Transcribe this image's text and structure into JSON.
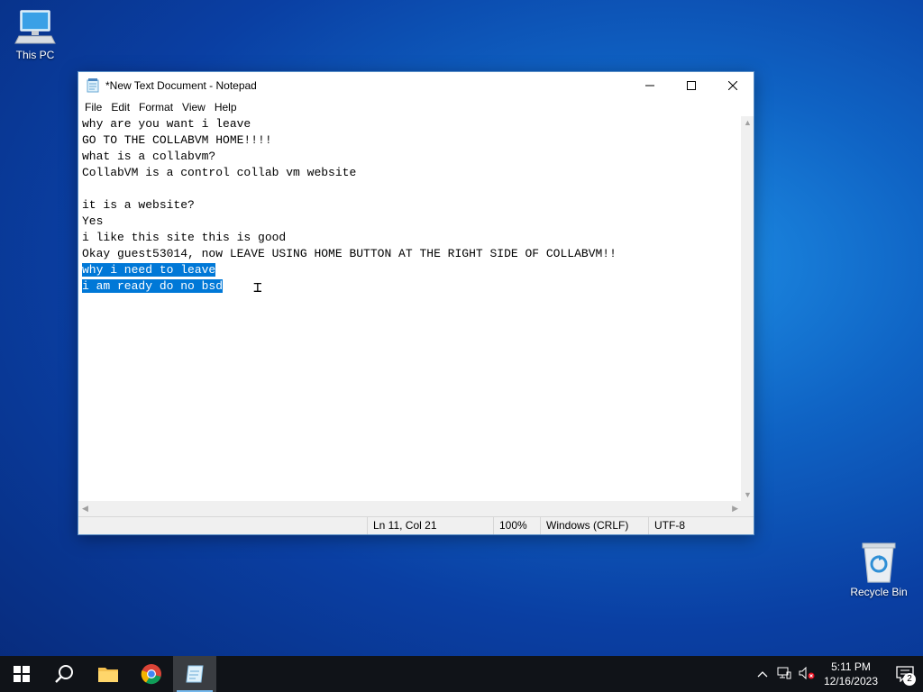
{
  "desktop": {
    "icons": [
      {
        "label": "This PC",
        "icon": "computer-icon"
      },
      {
        "label": "Recycle Bin",
        "icon": "recycle-bin-icon"
      }
    ]
  },
  "window": {
    "title": "*New Text Document - Notepad",
    "menu": [
      "File",
      "Edit",
      "Format",
      "View",
      "Help"
    ],
    "lines": [
      {
        "text": "why are you want i leave",
        "selected": false
      },
      {
        "text": "GO TO THE COLLABVM HOME!!!!",
        "selected": false
      },
      {
        "text": "what is a collabvm?",
        "selected": false
      },
      {
        "text": "CollabVM is a control collab vm website",
        "selected": false
      },
      {
        "text": "",
        "selected": false
      },
      {
        "text": "it is a website?",
        "selected": false
      },
      {
        "text": "Yes",
        "selected": false
      },
      {
        "text": "i like this site this is good",
        "selected": false
      },
      {
        "text": "Okay guest53014, now LEAVE USING HOME BUTTON AT THE RIGHT SIDE OF COLLABVM!!",
        "selected": false
      },
      {
        "text": "why i need to leave",
        "selected": true
      },
      {
        "text": "i am ready do no bsd",
        "selected": true
      }
    ],
    "status": {
      "position": "Ln 11, Col 21",
      "zoom": "100%",
      "line_ending": "Windows (CRLF)",
      "encoding": "UTF-8"
    }
  },
  "taskbar": {
    "time": "5:11 PM",
    "date": "12/16/2023",
    "notification_count": "2"
  },
  "colors": {
    "selection": "#0078d7",
    "taskbar": "#101318",
    "accent": "#76b9ed"
  }
}
